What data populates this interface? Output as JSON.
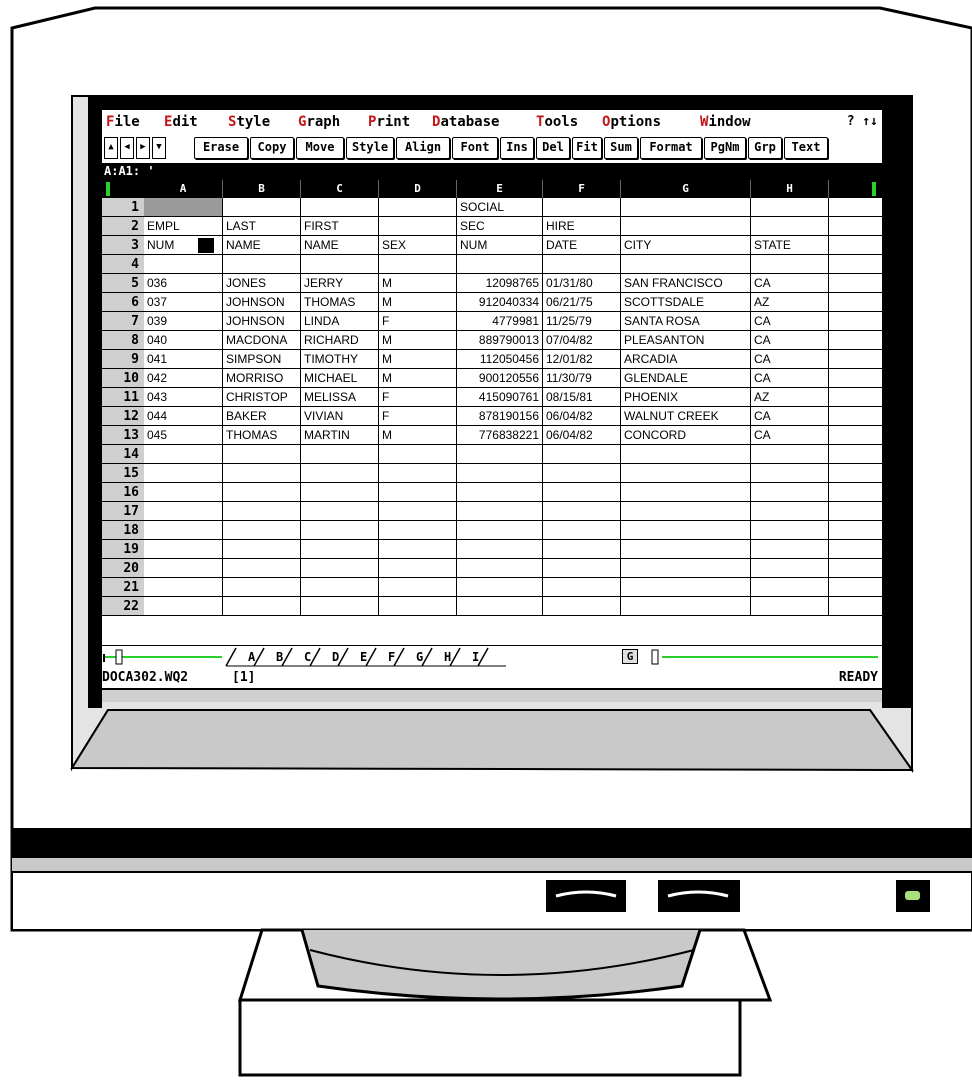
{
  "menu": {
    "items": [
      {
        "hotkey": "F",
        "rest": "ile"
      },
      {
        "hotkey": "E",
        "rest": "dit"
      },
      {
        "hotkey": "S",
        "rest": "tyle"
      },
      {
        "hotkey": "G",
        "rest": "raph"
      },
      {
        "hotkey": "P",
        "rest": "rint"
      },
      {
        "hotkey": "D",
        "rest": "atabase"
      },
      {
        "hotkey": "T",
        "rest": "ools"
      },
      {
        "hotkey": "O",
        "rest": "ptions"
      },
      {
        "hotkey": "W",
        "rest": "indow"
      }
    ],
    "right": "? ↑↓"
  },
  "toolbar": {
    "arrows": [
      "▲",
      "◀",
      "▶",
      "▼"
    ],
    "buttons": [
      "Erase",
      "Copy",
      "Move",
      "Style",
      "Align",
      "Font",
      "Ins",
      "Del",
      "Fit",
      "Sum",
      "Format",
      "PgNm",
      "Grp",
      "Text"
    ]
  },
  "address": "A:A1: '",
  "columns": [
    "A",
    "B",
    "C",
    "D",
    "E",
    "F",
    "G",
    "H"
  ],
  "rows": [
    {
      "n": "1",
      "cells": [
        "",
        "",
        "",
        "",
        "SOCIAL",
        "",
        "",
        ""
      ]
    },
    {
      "n": "2",
      "cells": [
        "EMPL",
        "LAST",
        "FIRST",
        "",
        "SEC",
        "HIRE",
        "",
        ""
      ]
    },
    {
      "n": "3",
      "cells": [
        "NUM",
        "NAME",
        "NAME",
        "SEX",
        "NUM",
        "DATE",
        "CITY",
        "STATE"
      ]
    },
    {
      "n": "4",
      "cells": [
        "",
        "",
        "",
        "",
        "",
        "",
        "",
        ""
      ]
    },
    {
      "n": "5",
      "cells": [
        "036",
        "JONES",
        "JERRY",
        "M",
        "12098765",
        "01/31/80",
        "SAN FRANCISCO",
        "CA"
      ]
    },
    {
      "n": "6",
      "cells": [
        "037",
        "JOHNSON",
        "THOMAS",
        "M",
        "912040334",
        "06/21/75",
        "SCOTTSDALE",
        "AZ"
      ]
    },
    {
      "n": "7",
      "cells": [
        "039",
        "JOHNSON",
        "LINDA",
        "F",
        "4779981",
        "11/25/79",
        "SANTA ROSA",
        "CA"
      ]
    },
    {
      "n": "8",
      "cells": [
        "040",
        "MACDONA",
        "RICHARD",
        "M",
        "889790013",
        "07/04/82",
        "PLEASANTON",
        "CA"
      ]
    },
    {
      "n": "9",
      "cells": [
        "041",
        "SIMPSON",
        "TIMOTHY",
        "M",
        "112050456",
        "12/01/82",
        "ARCADIA",
        "CA"
      ]
    },
    {
      "n": "10",
      "cells": [
        "042",
        "MORRISO",
        "MICHAEL",
        "M",
        "900120556",
        "11/30/79",
        "GLENDALE",
        "CA"
      ]
    },
    {
      "n": "11",
      "cells": [
        "043",
        "CHRISTOP",
        "MELISSA",
        "F",
        "415090761",
        "08/15/81",
        "PHOENIX",
        "AZ"
      ]
    },
    {
      "n": "12",
      "cells": [
        "044",
        "BAKER",
        "VIVIAN",
        "F",
        "878190156",
        "06/04/82",
        "WALNUT CREEK",
        "CA"
      ]
    },
    {
      "n": "13",
      "cells": [
        "045",
        "THOMAS",
        "MARTIN",
        "M",
        "776838221",
        "06/04/82",
        "CONCORD",
        "CA"
      ]
    },
    {
      "n": "14",
      "cells": [
        "",
        "",
        "",
        "",
        "",
        "",
        "",
        ""
      ]
    },
    {
      "n": "15",
      "cells": [
        "",
        "",
        "",
        "",
        "",
        "",
        "",
        ""
      ]
    },
    {
      "n": "16",
      "cells": [
        "",
        "",
        "",
        "",
        "",
        "",
        "",
        ""
      ]
    },
    {
      "n": "17",
      "cells": [
        "",
        "",
        "",
        "",
        "",
        "",
        "",
        ""
      ]
    },
    {
      "n": "18",
      "cells": [
        "",
        "",
        "",
        "",
        "",
        "",
        "",
        ""
      ]
    },
    {
      "n": "19",
      "cells": [
        "",
        "",
        "",
        "",
        "",
        "",
        "",
        ""
      ]
    },
    {
      "n": "20",
      "cells": [
        "",
        "",
        "",
        "",
        "",
        "",
        "",
        ""
      ]
    },
    {
      "n": "21",
      "cells": [
        "",
        "",
        "",
        "",
        "",
        "",
        "",
        ""
      ]
    },
    {
      "n": "22",
      "cells": [
        "",
        "",
        "",
        "",
        "",
        "",
        "",
        ""
      ]
    }
  ],
  "sheet_tabs": [
    "A",
    "B",
    "C",
    "D",
    "E",
    "F",
    "G",
    "H",
    "I"
  ],
  "group_label": "G",
  "status": {
    "file": "DOCA302.WQ2",
    "window": "[1]",
    "mode": "READY"
  },
  "colors": {
    "menu_hotkey": "#c41616",
    "scrollbar": "#2bd12b",
    "selected_cell": "#9a9a9a",
    "header_bg": "#000000"
  }
}
